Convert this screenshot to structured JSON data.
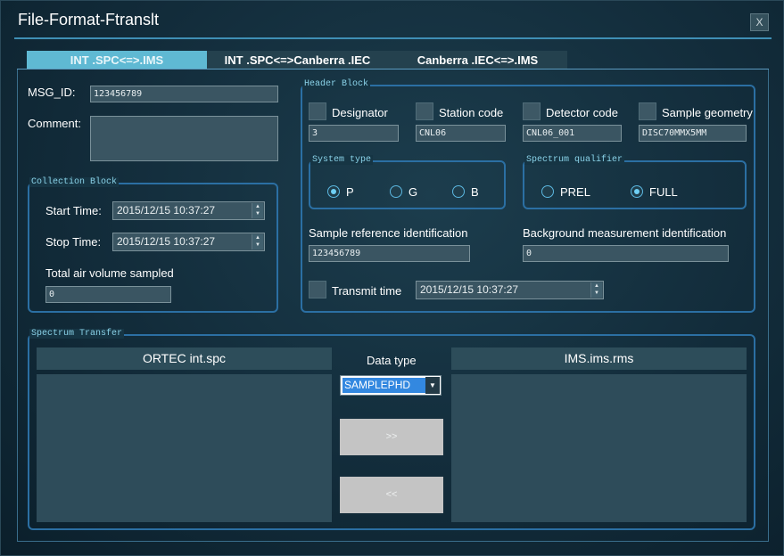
{
  "window": {
    "title": "File-Format-Ftranslt",
    "close_label": "X"
  },
  "tabs": [
    {
      "label": "INT .SPC<=>.IMS",
      "active": true
    },
    {
      "label": "INT .SPC<=>Canberra .IEC",
      "active": false
    },
    {
      "label": "Canberra .IEC<=>.IMS",
      "active": false
    }
  ],
  "form": {
    "msg_id_label": "MSG_ID:",
    "msg_id_value": "123456789",
    "comment_label": "Comment:",
    "comment_value": ""
  },
  "collection": {
    "title": "Collection Block",
    "start_label": "Start Time:",
    "start_value": "2015/12/15 10:37:27",
    "stop_label": "Stop Time:",
    "stop_value": "2015/12/15 10:37:27",
    "air_label": "Total air volume sampled",
    "air_value": "0"
  },
  "header": {
    "title": "Header Block",
    "designator_label": "Designator",
    "designator_value": "3",
    "station_label": "Station code",
    "station_value": "CNL06",
    "detector_label": "Detector code",
    "detector_value": "CNL06_001",
    "geometry_label": "Sample geometry",
    "geometry_value": "DISC70MMX5MM",
    "system_type": {
      "title": "System type",
      "options": [
        {
          "label": "P",
          "selected": true
        },
        {
          "label": "G",
          "selected": false
        },
        {
          "label": "B",
          "selected": false
        }
      ]
    },
    "spectrum_qualifier": {
      "title": "Spectrum qualifier",
      "options": [
        {
          "label": "PREL",
          "selected": false
        },
        {
          "label": "FULL",
          "selected": true
        }
      ]
    },
    "sample_ref_label": "Sample reference identification",
    "sample_ref_value": "123456789",
    "background_label": "Background measurement identification",
    "background_value": "0",
    "transmit_label": "Transmit time",
    "transmit_value": "2015/12/15 10:37:27"
  },
  "transfer": {
    "title": "Spectrum Transfer",
    "left_header": "ORTEC int.spc",
    "right_header": "IMS.ims.rms",
    "data_type_label": "Data type",
    "data_type_value": "SAMPLEPHD",
    "forward_label": ">>",
    "back_label": "<<"
  },
  "icons": {
    "spin_up": "▲",
    "spin_down": "▼",
    "dropdown": "▼"
  },
  "colors": {
    "accent": "#5fb9d3",
    "group_border": "#2b6fa3",
    "group_title": "#8ad2e8",
    "selection": "#3388e0"
  }
}
